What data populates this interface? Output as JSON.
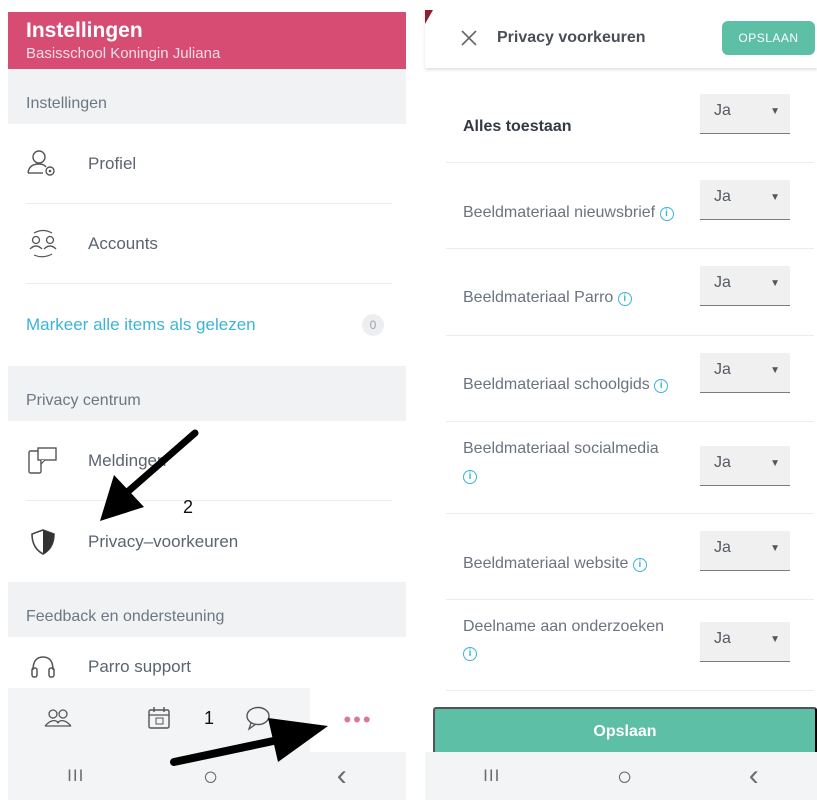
{
  "left": {
    "header": {
      "title": "Instellingen",
      "subtitle": "Basisschool Koningin Juliana"
    },
    "section_settings": "Instellingen",
    "items": [
      {
        "label": "Profiel",
        "icon": "profile-gear-icon"
      },
      {
        "label": "Accounts",
        "icon": "accounts-switch-icon"
      }
    ],
    "mark_read": {
      "label": "Markeer alle items als gelezen",
      "count": "0"
    },
    "section_privacy": "Privacy centrum",
    "privacy_items": [
      {
        "label": "Meldingen",
        "icon": "devices-icon"
      },
      {
        "label": "Privacy–voorkeuren",
        "icon": "shield-icon"
      }
    ],
    "section_feedback": "Feedback en ondersteuning",
    "support": {
      "label": "Parro support",
      "icon": "headset-icon"
    },
    "bottom_nav": [
      "group-icon",
      "calendar-icon",
      "chat-icon",
      "more-icon"
    ],
    "more_dots": "•••"
  },
  "right": {
    "title": "Privacy voorkeuren",
    "save_top": "OPSLAAN",
    "preferences": [
      {
        "label": "Alles toestaan",
        "value": "Ja",
        "info": false
      },
      {
        "label": "Beeldmateriaal nieuwsbrief",
        "value": "Ja",
        "info": true
      },
      {
        "label": "Beeldmateriaal Parro",
        "value": "Ja",
        "info": true
      },
      {
        "label": "Beeldmateriaal schoolgids",
        "value": "Ja",
        "info": true
      },
      {
        "label": "Beeldmateriaal socialmedia",
        "value": "Ja",
        "info": true
      },
      {
        "label": "Beeldmateriaal website",
        "value": "Ja",
        "info": true
      },
      {
        "label": "Deelname aan onderzoeken",
        "value": "Ja",
        "info": true
      }
    ],
    "save_big": "Opslaan"
  },
  "system_nav": {
    "recent": "III",
    "home": "○",
    "back": "‹"
  },
  "annotations": {
    "step1": "1",
    "step2": "2"
  },
  "colors": {
    "header": "#d64c73",
    "accent_teal": "#5dbfa5",
    "link_blue": "#3cb4d8"
  }
}
